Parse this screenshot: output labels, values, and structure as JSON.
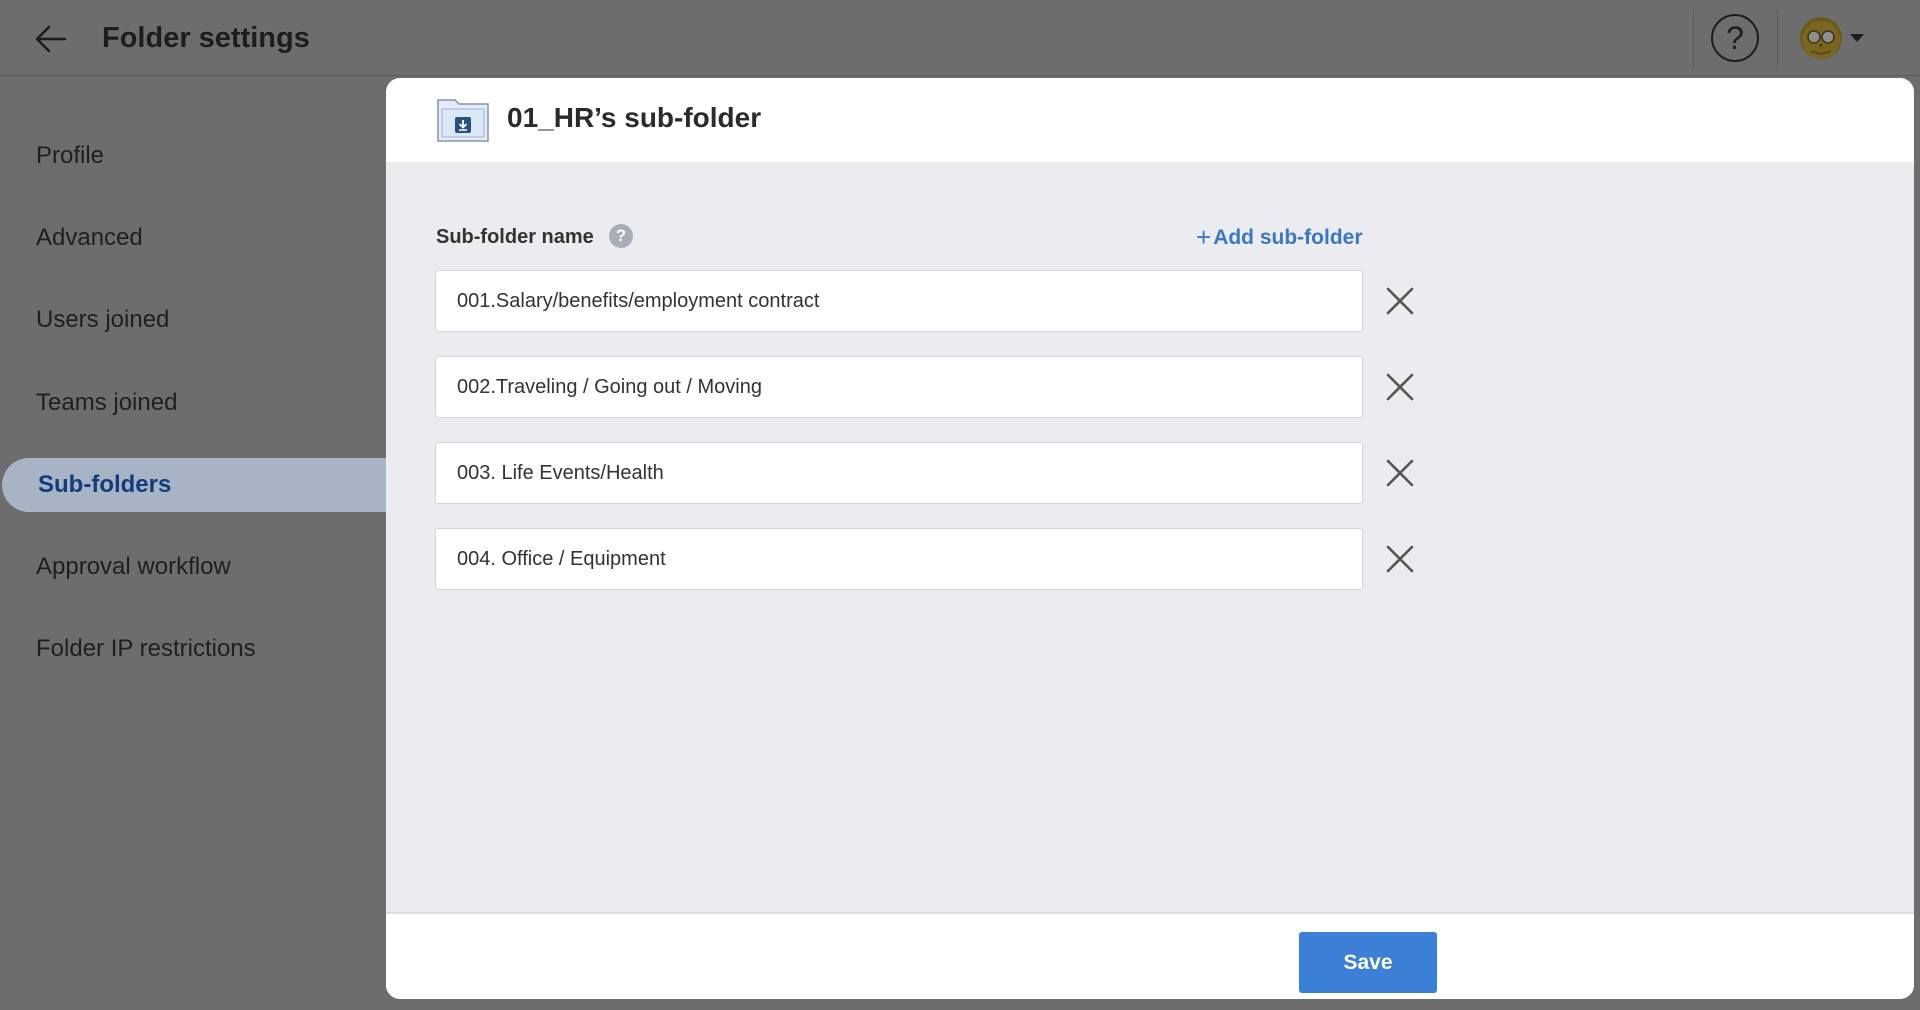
{
  "header": {
    "title": "Folder settings",
    "back_icon": "arrow-left-icon",
    "help_icon": "question-circle-icon",
    "help_symbol": "?"
  },
  "sidebar": {
    "items": [
      {
        "label": "Profile",
        "active": false
      },
      {
        "label": "Advanced",
        "active": false
      },
      {
        "label": "Users joined",
        "active": false
      },
      {
        "label": "Teams joined",
        "active": false
      },
      {
        "label": "Sub-folders",
        "active": true
      },
      {
        "label": "Approval workflow",
        "active": false
      },
      {
        "label": "Folder IP restrictions",
        "active": false
      }
    ]
  },
  "modal": {
    "title": "01_HR’s sub-folder",
    "field_label": "Sub-folder name",
    "help_symbol": "?",
    "add_plus": "+",
    "add_label": "Add sub-folder",
    "subfolders": [
      {
        "value": "001.Salary/benefits/employment contract"
      },
      {
        "value": "002.Traveling / Going out / Moving"
      },
      {
        "value": "003. Life Events/Health"
      },
      {
        "value": "004. Office / Equipment"
      }
    ],
    "save_label": "Save"
  },
  "colors": {
    "overlay": "#6d6d6d",
    "accent": "#3b7fd6",
    "link": "#3a77c9",
    "active_nav_text": "#163b7a"
  }
}
